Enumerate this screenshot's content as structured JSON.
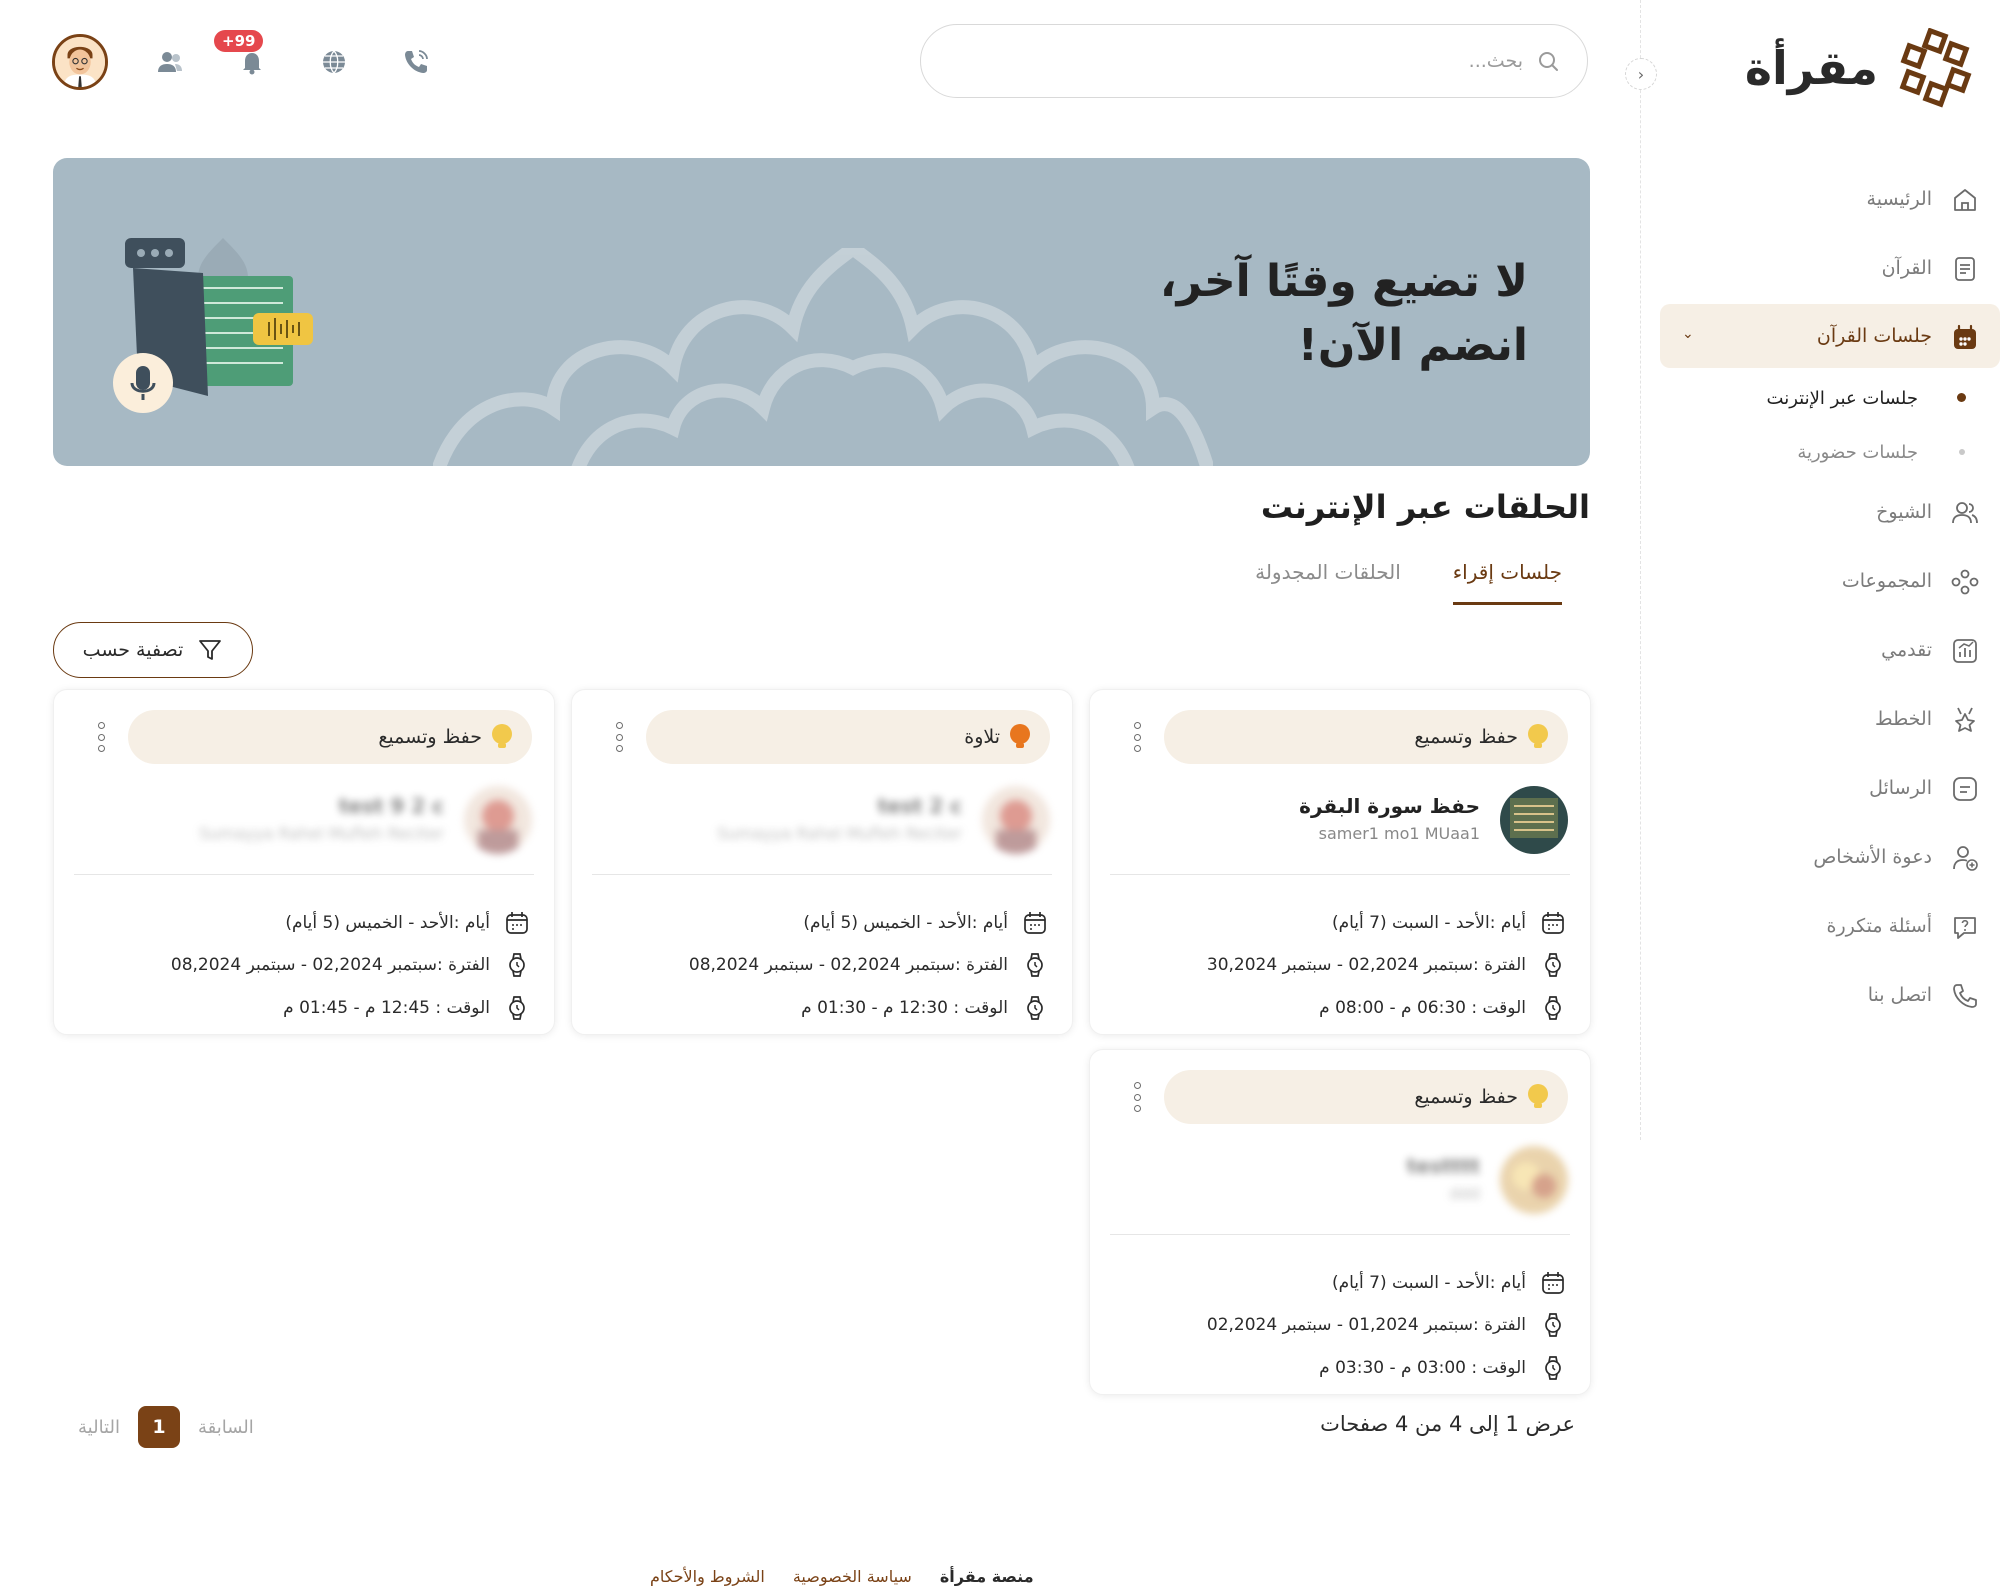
{
  "sidebar": {
    "logo_text": "مقرأة",
    "items": [
      {
        "label": "الرئيسية",
        "icon": "home-icon"
      },
      {
        "label": "القرآن",
        "icon": "book-icon"
      },
      {
        "label": "جلسات القرآن",
        "icon": "calendar-icon",
        "active": true
      },
      {
        "label": "الشيوخ",
        "icon": "users-icon"
      },
      {
        "label": "المجموعات",
        "icon": "groups-icon"
      },
      {
        "label": "تقدمي",
        "icon": "chart-icon"
      },
      {
        "label": "الخطط",
        "icon": "star-icon"
      },
      {
        "label": "الرسائل",
        "icon": "message-icon"
      },
      {
        "label": "دعوة الأشخاص",
        "icon": "user-plus-icon"
      },
      {
        "label": "أسئلة متكررة",
        "icon": "question-icon"
      },
      {
        "label": "اتصل بنا",
        "icon": "phone-icon"
      }
    ],
    "sub_items": [
      {
        "label": "جلسات عبر الإنترنت",
        "active": true
      },
      {
        "label": "جلسات حضورية",
        "active": false
      }
    ]
  },
  "header": {
    "search_placeholder": "بحث...",
    "notification_count": "+99"
  },
  "banner": {
    "line1": "لا تضيع وقتًا آخر،",
    "line2": "انضم الآن!"
  },
  "section": {
    "title": "الحلقات عبر الإنترنت",
    "tabs": [
      "جلسات إقراء",
      "الحلقات المجدولة"
    ],
    "filter_label": "تصفية حسب"
  },
  "cards": [
    {
      "type": "حفظ وتسميع",
      "type_color": "#f2c94c",
      "teacher_name": "حفظ سورة البقرة",
      "teacher_sub": "samer1 mo1 MUaa1",
      "days": "أيام :الأحد - السبت (7 أيام)",
      "period": "الفترة :سبتمبر 02,2024 - سبتمبر 30,2024",
      "time": "الوقت : 06:30 م - 08:00 م"
    },
    {
      "type": "تلاوة",
      "type_color": "#e8761e",
      "teacher_name": "test 2 c",
      "teacher_sub": "Sumayya Rahel Mufleh Reciter",
      "days": "أيام :الأحد - الخميس (5 أيام)",
      "period": "الفترة :سبتمبر 02,2024 - سبتمبر 08,2024",
      "time": "الوقت : 12:30 م - 01:30 م"
    },
    {
      "type": "حفظ وتسميع",
      "type_color": "#f2c94c",
      "teacher_name": "test 9 2 c",
      "teacher_sub": "Sumayya Rahel Mufleh Reciter",
      "days": "أيام :الأحد - الخميس (5 أيام)",
      "period": "الفترة :سبتمبر 02,2024 - سبتمبر 08,2024",
      "time": "الوقت : 12:45 م - 01:45 م"
    },
    {
      "type": "حفظ وتسميع",
      "type_color": "#f2c94c",
      "teacher_name": "testttt",
      "teacher_sub": "ddd",
      "days": "أيام :الأحد - السبت (7 أيام)",
      "period": "الفترة :سبتمبر 01,2024 - سبتمبر 02,2024",
      "time": "الوقت : 03:00 م - 03:30 م"
    }
  ],
  "pagination": {
    "info": "عرض 1 إلى 4 من 4 صفحات",
    "prev": "السابقة",
    "next": "التالية",
    "current": "1"
  },
  "footer": {
    "brand": "منصة مقرأة",
    "privacy": "سياسة الخصوصية",
    "terms": "الشروط والأحكام"
  },
  "colors": {
    "brand": "#6a3a12",
    "banner": "#a7b9c4",
    "chip": "#f6efe5"
  }
}
